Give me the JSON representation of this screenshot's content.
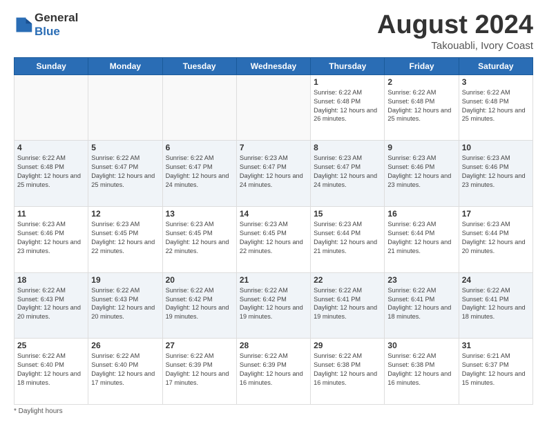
{
  "header": {
    "logo_general": "General",
    "logo_blue": "Blue",
    "month_title": "August 2024",
    "location": "Takouabli, Ivory Coast"
  },
  "days_of_week": [
    "Sunday",
    "Monday",
    "Tuesday",
    "Wednesday",
    "Thursday",
    "Friday",
    "Saturday"
  ],
  "footer": {
    "note": "Daylight hours"
  },
  "weeks": [
    [
      {
        "day": "",
        "info": ""
      },
      {
        "day": "",
        "info": ""
      },
      {
        "day": "",
        "info": ""
      },
      {
        "day": "",
        "info": ""
      },
      {
        "day": "1",
        "info": "Sunrise: 6:22 AM\nSunset: 6:48 PM\nDaylight: 12 hours\nand 26 minutes."
      },
      {
        "day": "2",
        "info": "Sunrise: 6:22 AM\nSunset: 6:48 PM\nDaylight: 12 hours\nand 25 minutes."
      },
      {
        "day": "3",
        "info": "Sunrise: 6:22 AM\nSunset: 6:48 PM\nDaylight: 12 hours\nand 25 minutes."
      }
    ],
    [
      {
        "day": "4",
        "info": "Sunrise: 6:22 AM\nSunset: 6:48 PM\nDaylight: 12 hours\nand 25 minutes."
      },
      {
        "day": "5",
        "info": "Sunrise: 6:22 AM\nSunset: 6:47 PM\nDaylight: 12 hours\nand 25 minutes."
      },
      {
        "day": "6",
        "info": "Sunrise: 6:22 AM\nSunset: 6:47 PM\nDaylight: 12 hours\nand 24 minutes."
      },
      {
        "day": "7",
        "info": "Sunrise: 6:23 AM\nSunset: 6:47 PM\nDaylight: 12 hours\nand 24 minutes."
      },
      {
        "day": "8",
        "info": "Sunrise: 6:23 AM\nSunset: 6:47 PM\nDaylight: 12 hours\nand 24 minutes."
      },
      {
        "day": "9",
        "info": "Sunrise: 6:23 AM\nSunset: 6:46 PM\nDaylight: 12 hours\nand 23 minutes."
      },
      {
        "day": "10",
        "info": "Sunrise: 6:23 AM\nSunset: 6:46 PM\nDaylight: 12 hours\nand 23 minutes."
      }
    ],
    [
      {
        "day": "11",
        "info": "Sunrise: 6:23 AM\nSunset: 6:46 PM\nDaylight: 12 hours\nand 23 minutes."
      },
      {
        "day": "12",
        "info": "Sunrise: 6:23 AM\nSunset: 6:45 PM\nDaylight: 12 hours\nand 22 minutes."
      },
      {
        "day": "13",
        "info": "Sunrise: 6:23 AM\nSunset: 6:45 PM\nDaylight: 12 hours\nand 22 minutes."
      },
      {
        "day": "14",
        "info": "Sunrise: 6:23 AM\nSunset: 6:45 PM\nDaylight: 12 hours\nand 22 minutes."
      },
      {
        "day": "15",
        "info": "Sunrise: 6:23 AM\nSunset: 6:44 PM\nDaylight: 12 hours\nand 21 minutes."
      },
      {
        "day": "16",
        "info": "Sunrise: 6:23 AM\nSunset: 6:44 PM\nDaylight: 12 hours\nand 21 minutes."
      },
      {
        "day": "17",
        "info": "Sunrise: 6:23 AM\nSunset: 6:44 PM\nDaylight: 12 hours\nand 20 minutes."
      }
    ],
    [
      {
        "day": "18",
        "info": "Sunrise: 6:22 AM\nSunset: 6:43 PM\nDaylight: 12 hours\nand 20 minutes."
      },
      {
        "day": "19",
        "info": "Sunrise: 6:22 AM\nSunset: 6:43 PM\nDaylight: 12 hours\nand 20 minutes."
      },
      {
        "day": "20",
        "info": "Sunrise: 6:22 AM\nSunset: 6:42 PM\nDaylight: 12 hours\nand 19 minutes."
      },
      {
        "day": "21",
        "info": "Sunrise: 6:22 AM\nSunset: 6:42 PM\nDaylight: 12 hours\nand 19 minutes."
      },
      {
        "day": "22",
        "info": "Sunrise: 6:22 AM\nSunset: 6:41 PM\nDaylight: 12 hours\nand 19 minutes."
      },
      {
        "day": "23",
        "info": "Sunrise: 6:22 AM\nSunset: 6:41 PM\nDaylight: 12 hours\nand 18 minutes."
      },
      {
        "day": "24",
        "info": "Sunrise: 6:22 AM\nSunset: 6:41 PM\nDaylight: 12 hours\nand 18 minutes."
      }
    ],
    [
      {
        "day": "25",
        "info": "Sunrise: 6:22 AM\nSunset: 6:40 PM\nDaylight: 12 hours\nand 18 minutes."
      },
      {
        "day": "26",
        "info": "Sunrise: 6:22 AM\nSunset: 6:40 PM\nDaylight: 12 hours\nand 17 minutes."
      },
      {
        "day": "27",
        "info": "Sunrise: 6:22 AM\nSunset: 6:39 PM\nDaylight: 12 hours\nand 17 minutes."
      },
      {
        "day": "28",
        "info": "Sunrise: 6:22 AM\nSunset: 6:39 PM\nDaylight: 12 hours\nand 16 minutes."
      },
      {
        "day": "29",
        "info": "Sunrise: 6:22 AM\nSunset: 6:38 PM\nDaylight: 12 hours\nand 16 minutes."
      },
      {
        "day": "30",
        "info": "Sunrise: 6:22 AM\nSunset: 6:38 PM\nDaylight: 12 hours\nand 16 minutes."
      },
      {
        "day": "31",
        "info": "Sunrise: 6:21 AM\nSunset: 6:37 PM\nDaylight: 12 hours\nand 15 minutes."
      }
    ]
  ]
}
